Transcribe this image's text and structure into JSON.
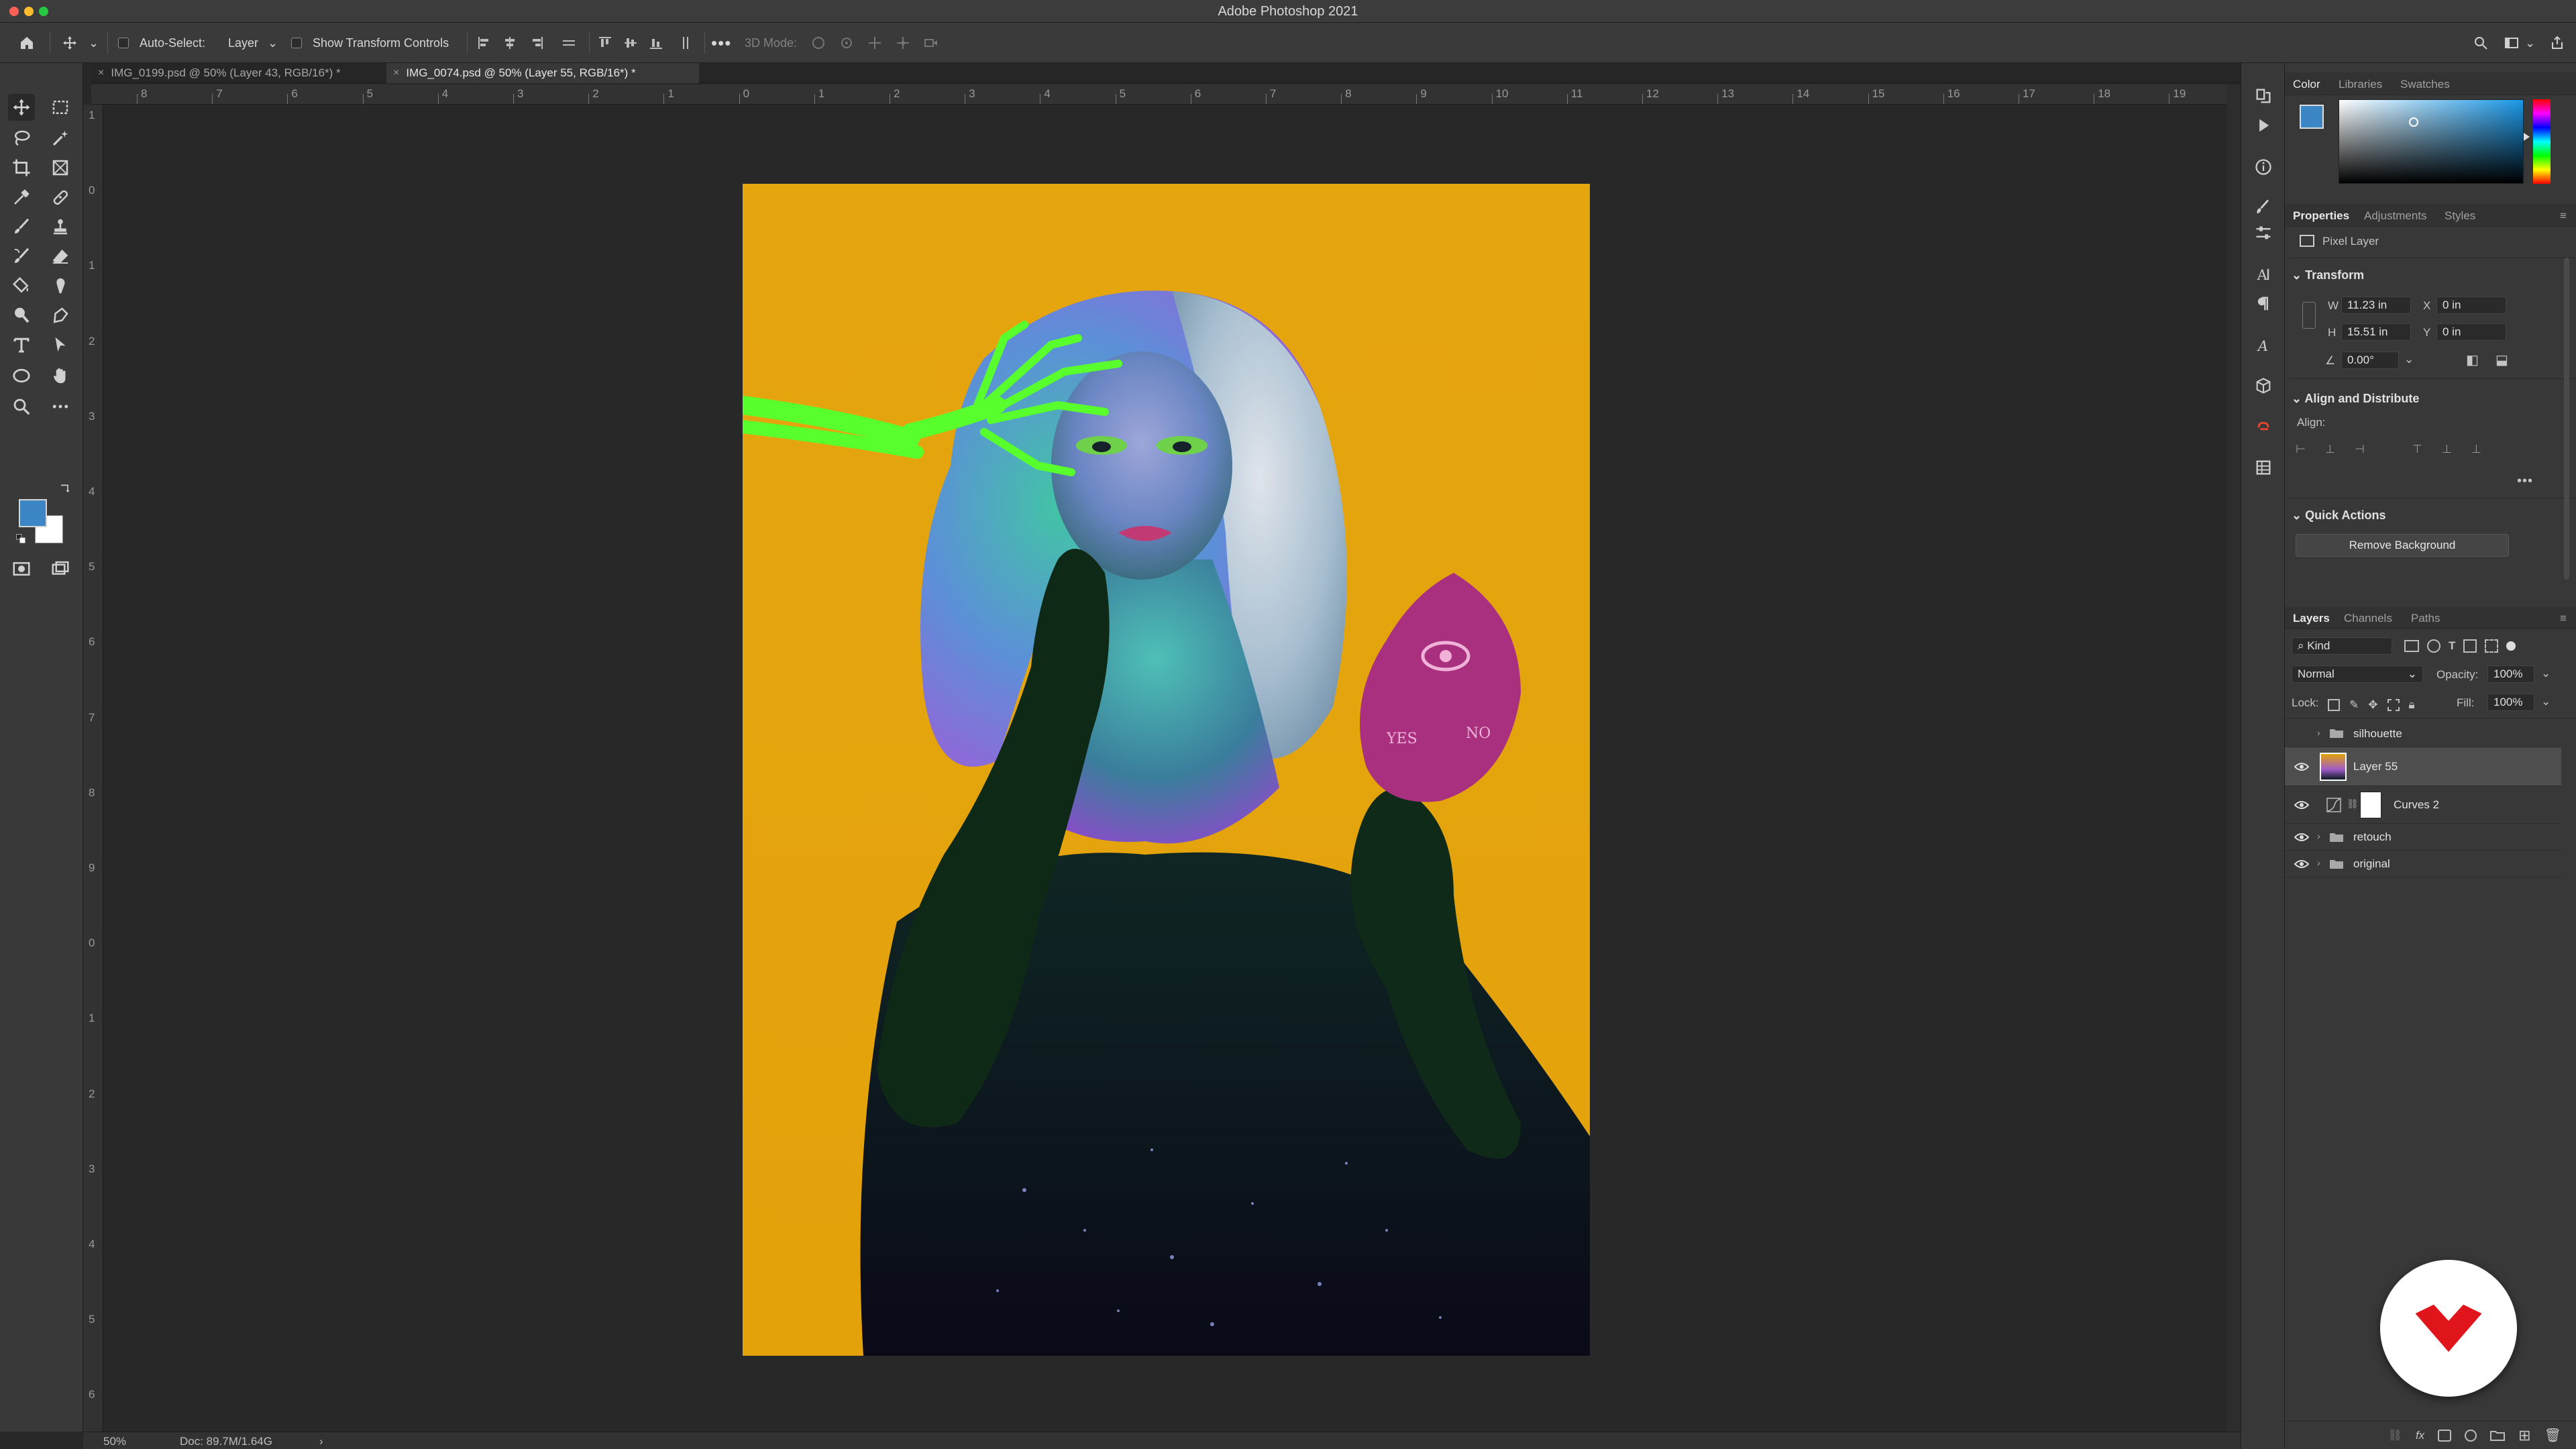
{
  "app": {
    "title": "Adobe Photoshop 2021"
  },
  "options_bar": {
    "auto_select_label": "Auto-Select:",
    "auto_select_target": "Layer",
    "show_transform_label": "Show Transform Controls",
    "mode_3d_label": "3D Mode:",
    "more_icon": "ellipsis-icon"
  },
  "tabs": [
    {
      "label": "IMG_0199.psd @ 50% (Layer 43, RGB/16*) *",
      "active": false
    },
    {
      "label": "IMG_0074.psd @ 50% (Layer 55, RGB/16*) *",
      "active": true
    }
  ],
  "ruler": {
    "h_labels": [
      "8",
      "7",
      "6",
      "5",
      "4",
      "3",
      "2",
      "1",
      "0",
      "1",
      "2",
      "3",
      "4",
      "5",
      "6",
      "7",
      "8",
      "9",
      "10",
      "11",
      "12",
      "13",
      "14",
      "15",
      "16",
      "17",
      "18",
      "19"
    ],
    "v_labels": [
      "1",
      "0",
      "1",
      "2",
      "3",
      "4",
      "5",
      "6",
      "7",
      "8",
      "9",
      "0",
      "1",
      "2",
      "3",
      "4",
      "5",
      "6"
    ]
  },
  "status": {
    "zoom": "50%",
    "doc": "Doc: 89.7M/1.64G",
    "arrow": "›"
  },
  "colors": {
    "foreground": "#3d86c6",
    "background": "#ffffff",
    "canvas_backdrop": "#e8a90c",
    "accent_logo": "#e0151c"
  },
  "color_panel": {
    "tabs": [
      "Color",
      "Libraries",
      "Swatches"
    ]
  },
  "properties": {
    "tabs": [
      "Properties",
      "Adjustments",
      "Styles"
    ],
    "layer_type": "Pixel Layer",
    "transform_title": "Transform",
    "w_label": "W",
    "w_value": "11.23 in",
    "h_label": "H",
    "h_value": "15.51 in",
    "x_label": "X",
    "x_value": "0 in",
    "y_label": "Y",
    "y_value": "0 in",
    "angle_value": "0.00°",
    "align_title": "Align and Distribute",
    "align_label": "Align:",
    "quick_actions_title": "Quick Actions",
    "remove_bg_button": "Remove Background"
  },
  "layers_panel": {
    "tabs": [
      "Layers",
      "Channels",
      "Paths"
    ],
    "kind_filter": "Kind",
    "blend_mode": "Normal",
    "opacity_label": "Opacity:",
    "opacity_value": "100%",
    "lock_label": "Lock:",
    "fill_label": "Fill:",
    "fill_value": "100%",
    "layers": [
      {
        "name": "silhouette",
        "type": "group",
        "visible": false,
        "selected": false
      },
      {
        "name": "Layer 55",
        "type": "pixel",
        "visible": true,
        "selected": true
      },
      {
        "name": "Curves 2",
        "type": "adjustment",
        "visible": true,
        "selected": false
      },
      {
        "name": "retouch",
        "type": "group",
        "visible": true,
        "selected": false
      },
      {
        "name": "original",
        "type": "group",
        "visible": true,
        "selected": false
      }
    ]
  },
  "planchette": {
    "yes": "YES",
    "no": "NO"
  }
}
